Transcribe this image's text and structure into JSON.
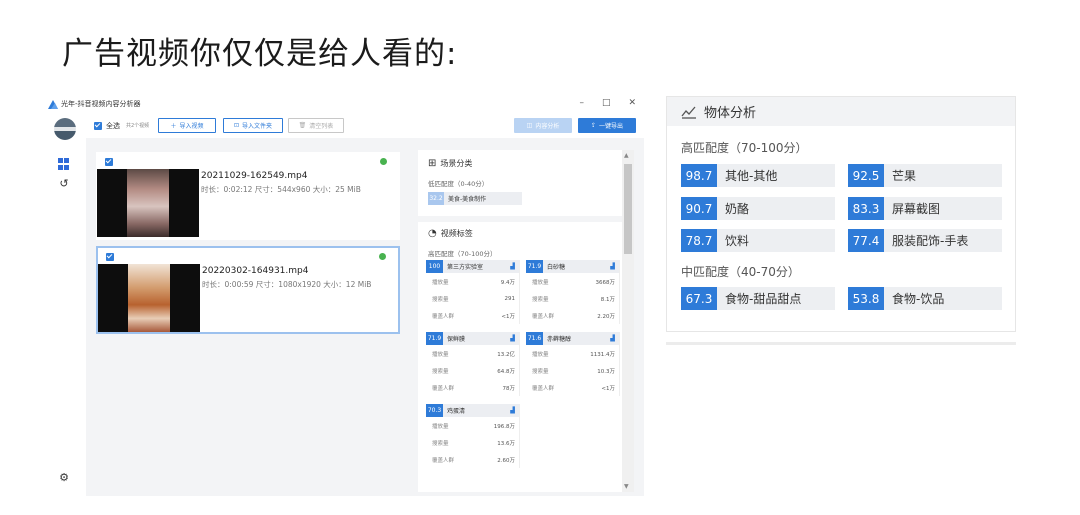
{
  "headline": "广告视频你仅仅是给人看的:",
  "app": {
    "title": "光年-抖音视频内容分析器",
    "window_buttons": [
      "–",
      "□",
      "✕"
    ],
    "toolbar": {
      "select_all": "全选",
      "count": "共2个视频",
      "import_video": "导入视频",
      "import_folder": "导入文件夹",
      "clear_list": "清空列表",
      "content_analysis": "内容分析",
      "one_click_export": "一键导出"
    },
    "files": [
      {
        "name": "20211029-162549.mp4",
        "meta": "时长：0:02:12  尺寸：544x960  大小：25 MiB"
      },
      {
        "name": "20220302-164931.mp4",
        "meta": "时长：0:00:59  尺寸：1080x1920  大小：12 MiB"
      }
    ],
    "scene": {
      "title": "场景分类",
      "sub": "低匹配度（0-40分）",
      "tag_score": "32.2",
      "tag_label": "美食-美食制作"
    },
    "video_tags": {
      "title": "视频标签",
      "sub": "高匹配度（70-100分）",
      "row_labels": [
        "播放量",
        "搜索量",
        "覆盖人群"
      ],
      "cards": [
        {
          "score": "100",
          "label": "第三方实验室",
          "values": [
            "9.4万",
            "291",
            "<1万"
          ]
        },
        {
          "score": "71.9",
          "label": "白砂糖",
          "values": [
            "3668万",
            "8.1万",
            "2.20万"
          ]
        },
        {
          "score": "71.9",
          "label": "保鲜膜",
          "values": [
            "13.2亿",
            "64.8万",
            "78万"
          ]
        },
        {
          "score": "71.6",
          "label": "赤藓糖醇",
          "values": [
            "1131.4万",
            "10.3万",
            "<1万"
          ]
        },
        {
          "score": "70.3",
          "label": "鸡蛋清",
          "values": [
            "196.8万",
            "13.6万",
            "2.60万"
          ]
        }
      ]
    }
  },
  "object_analysis": {
    "title": "物体分析",
    "high": {
      "label": "高匹配度（70-100分）",
      "tags": [
        {
          "score": "98.7",
          "label": "其他-其他"
        },
        {
          "score": "92.5",
          "label": "芒果"
        },
        {
          "score": "90.7",
          "label": "奶酪"
        },
        {
          "score": "83.3",
          "label": "屏幕截图"
        },
        {
          "score": "78.7",
          "label": "饮料"
        },
        {
          "score": "77.4",
          "label": "服装配饰-手表"
        }
      ]
    },
    "mid": {
      "label": "中匹配度（40-70分）",
      "tags": [
        {
          "score": "67.3",
          "label": "食物-甜品甜点"
        },
        {
          "score": "53.8",
          "label": "食物-饮品"
        }
      ]
    }
  },
  "colors": {
    "accent": "#2e7bd8",
    "ok": "#48b24f"
  },
  "icons": {
    "chart": "chart-icon",
    "scene": "grid-icon",
    "tag": "tag-icon",
    "settings": "gear-icon"
  }
}
